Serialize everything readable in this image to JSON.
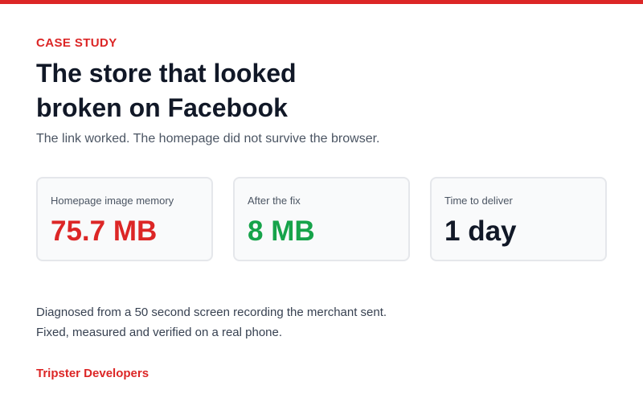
{
  "eyebrow": "CASE STUDY",
  "title": "The store that looked broken on Facebook",
  "subtitle": "The link worked. The homepage did not survive the browser.",
  "stats": [
    {
      "label": "Homepage image memory",
      "value": "75.7 MB",
      "color": "#dc2626"
    },
    {
      "label": "After the fix",
      "value": "8 MB",
      "color": "#16a34a"
    },
    {
      "label": "Time to deliver",
      "value": "1 day",
      "color": "#111827"
    }
  ],
  "notes": [
    "Diagnosed from a 50 second screen recording the merchant sent.",
    "Fixed, measured and verified on a real phone."
  ],
  "brand": "Tripster Developers",
  "colors": {
    "accent": "#dc2626",
    "success": "#16a34a",
    "heading": "#111827"
  }
}
